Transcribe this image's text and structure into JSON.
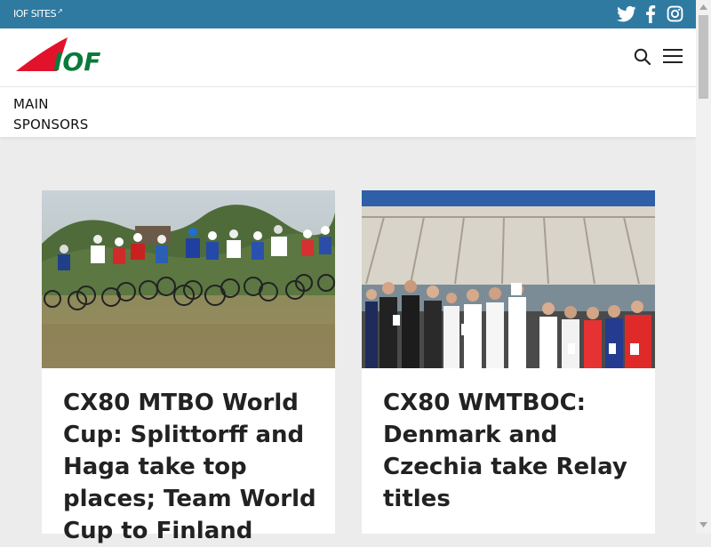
{
  "topbar": {
    "sites_label": "IOF SITES",
    "external_glyph": "↗",
    "social_icons": [
      "twitter-icon",
      "facebook-icon",
      "instagram-icon"
    ]
  },
  "header": {
    "logo_text": "IOF",
    "icons": [
      "search-icon",
      "menu-icon"
    ]
  },
  "subnav": {
    "items": [
      {
        "label": "MAIN"
      },
      {
        "label": "SPONSORS"
      }
    ]
  },
  "news": {
    "items": [
      {
        "title": "CX80 MTBO World Cup: Splittorff and Haga take top places; Team World Cup to Finland",
        "image": "mountain-bike-race-photo"
      },
      {
        "title": "CX80 WMTBOC: Denmark and Czechia take Relay titles",
        "image": "podium-ceremony-photo"
      }
    ]
  },
  "colors": {
    "topbar": "#2f7aa1",
    "logo_red": "#e3122b",
    "logo_green": "#0a7a3a",
    "page_bg": "#ececec"
  }
}
